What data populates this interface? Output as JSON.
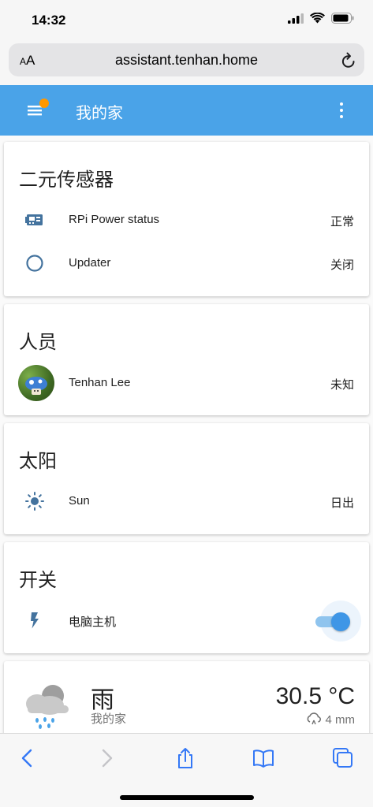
{
  "status_bar": {
    "time": "14:32"
  },
  "browser": {
    "aa_small": "A",
    "aa_large": "A",
    "url": "assistant.tenhan.home"
  },
  "header": {
    "title": "我的家"
  },
  "cards": {
    "binary_sensors": {
      "title": "二元传感器",
      "items": [
        {
          "name": "RPi Power status",
          "state": "正常",
          "icon": "raspberry-pi-icon"
        },
        {
          "name": "Updater",
          "state": "关闭",
          "icon": "circle-outline-icon"
        }
      ]
    },
    "persons": {
      "title": "人员",
      "items": [
        {
          "name": "Tenhan Lee",
          "state": "未知",
          "icon": "avatar"
        }
      ]
    },
    "sun": {
      "title": "太阳",
      "items": [
        {
          "name": "Sun",
          "state": "日出",
          "icon": "sun-icon"
        }
      ]
    },
    "switches": {
      "title": "开关",
      "items": [
        {
          "name": "电脑主机",
          "state": "on",
          "icon": "flash-icon"
        }
      ]
    },
    "weather": {
      "condition": "雨",
      "location": "我的家",
      "temperature": "30.5 °C",
      "precipitation": "4 mm"
    }
  },
  "colors": {
    "header": "#4aa3e8",
    "accent": "#3f96e6",
    "badge": "#ff9800",
    "icon": "#44739e",
    "ios_blue": "#3478f6"
  }
}
